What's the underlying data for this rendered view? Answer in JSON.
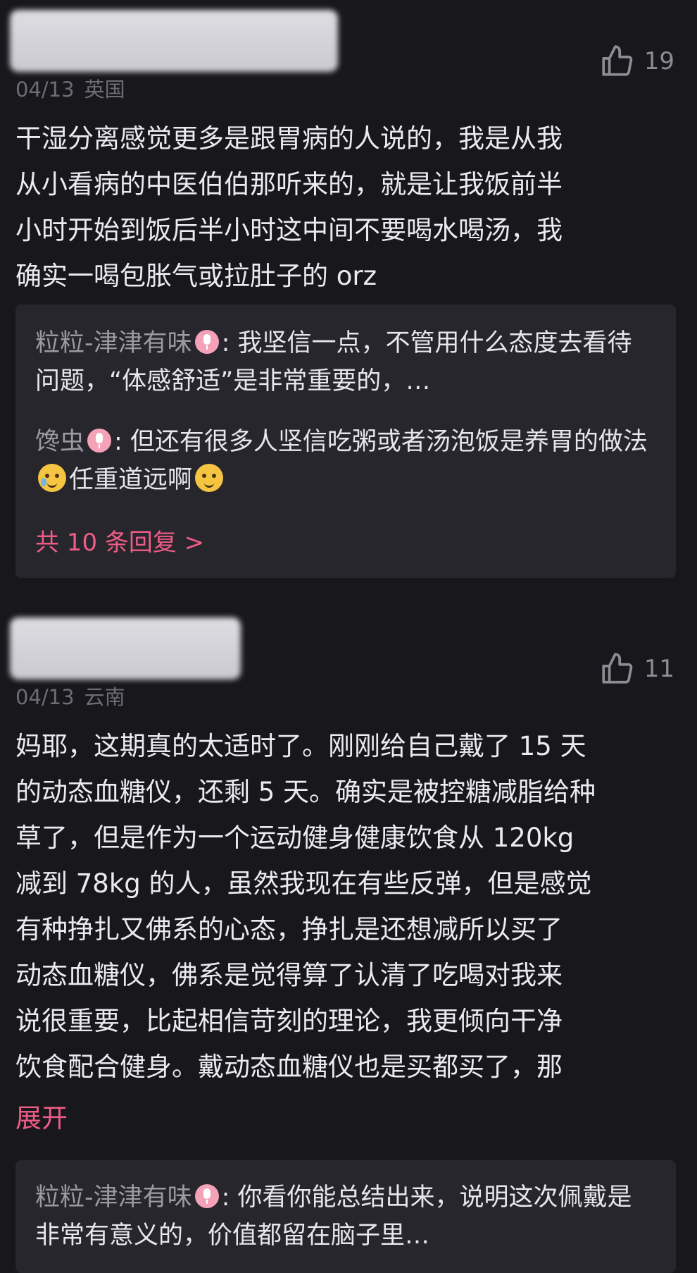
{
  "comments": [
    {
      "date": "04/13",
      "location": "英国",
      "likes": "19",
      "text": "干湿分离感觉更多是跟胃病的人说的，我是从我\n从小看病的中医伯伯那听来的，就是让我饭前半\n小时开始到饭后半小时这中间不要喝水喝汤，我\n确实一喝包胀气或拉肚子的 orz",
      "replies": [
        {
          "name": "粒粒-津津有味",
          "text": ": 我坚信一点，不管用什么态度去看待问题，“体感舒适”是非常重要的，…"
        },
        {
          "name": "馋虫",
          "text_a": ": 但还有很多人坚信吃粥或者汤泡饭是养胃的做法",
          "text_b": "任重道远啊"
        }
      ],
      "more_replies": "共 10 条回复 >"
    },
    {
      "date": "04/13",
      "location": "云南",
      "likes": "11",
      "text": "妈耶，这期真的太适时了。刚刚给自己戴了 15 天\n的动态血糖仪，还剩 5 天。确实是被控糖减脂给种\n草了，但是作为一个运动健身健康饮食从 120kg\n减到 78kg 的人，虽然我现在有些反弹，但是感觉\n有种挣扎又佛系的心态，挣扎是还想减所以买了\n动态血糖仪，佛系是觉得算了认清了吃喝对我来\n说很重要，比起相信苛刻的理论，我更倾向干净\n饮食配合健身。戴动态血糖仪也是买都买了，那",
      "expand": "展开",
      "replies": [
        {
          "name": "粒粒-津津有味",
          "text": ": 你看你能总结出来，说明这次佩戴是非常有意义的，价值都留在脑子里…"
        }
      ]
    }
  ]
}
